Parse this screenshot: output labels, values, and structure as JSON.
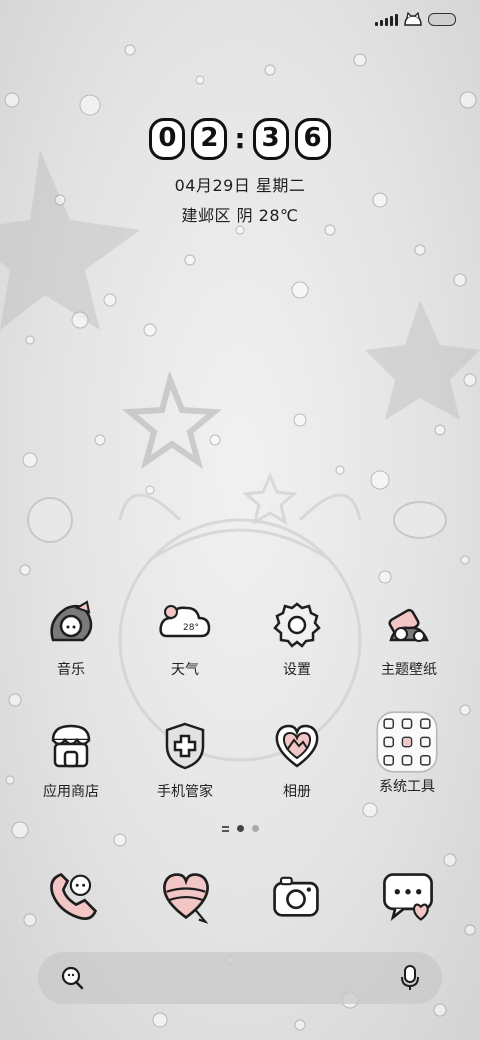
{
  "lockscreen": {
    "time_digits": [
      "0",
      "2",
      "3",
      "6"
    ],
    "time_separator": ":",
    "date": "04月29日 星期二",
    "weather": "建邺区 阴 28℃"
  },
  "apps": [
    {
      "label": "音乐",
      "icon": "music-icon"
    },
    {
      "label": "天气",
      "icon": "weather-icon",
      "badge": "28°"
    },
    {
      "label": "设置",
      "icon": "settings-icon"
    },
    {
      "label": "主题壁纸",
      "icon": "theme-icon"
    },
    {
      "label": "应用商店",
      "icon": "app-store-icon"
    },
    {
      "label": "手机管家",
      "icon": "phone-manager-icon"
    },
    {
      "label": "相册",
      "icon": "gallery-icon"
    },
    {
      "label": "系统工具",
      "icon": "system-tools-icon"
    }
  ],
  "dock": [
    {
      "icon": "phone-icon"
    },
    {
      "icon": "contacts-icon"
    },
    {
      "icon": "camera-icon"
    },
    {
      "icon": "messages-icon"
    }
  ],
  "page_indicator": {
    "pages": 2,
    "current": 1
  },
  "search": {
    "icon": "search-icon",
    "voice_icon": "microphone-icon"
  },
  "status_bar": {
    "icons": [
      "signal-icon",
      "cat-icon",
      "battery-icon"
    ]
  },
  "colors": {
    "accent_pink": "#f3c6c6",
    "outline": "#1e1e1e"
  }
}
